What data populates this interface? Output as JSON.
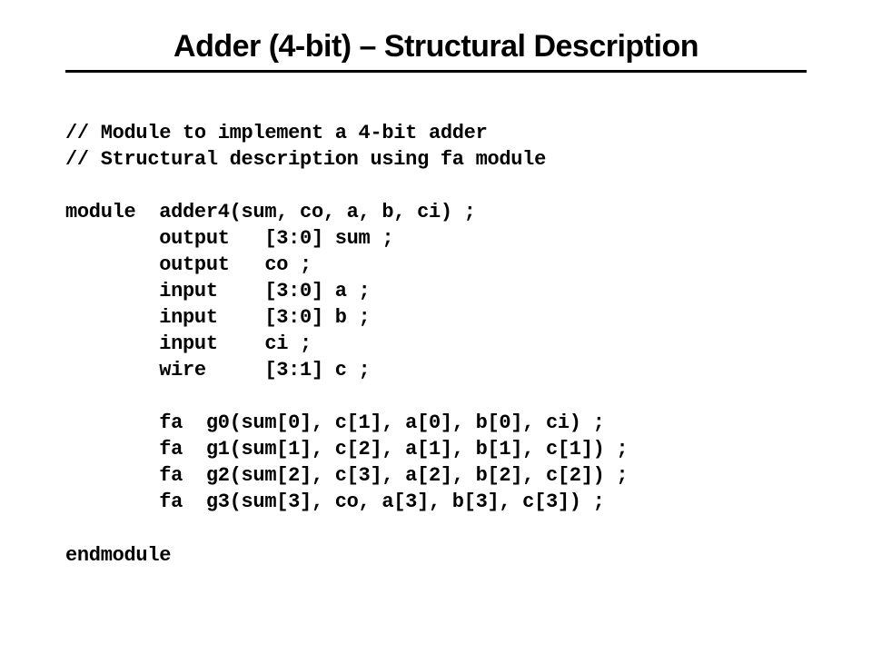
{
  "title": "Adder (4-bit) – Structural Description",
  "code": {
    "l01": "// Module to implement a 4-bit adder",
    "l02": "// Structural description using fa module",
    "l03": "",
    "l04": "module  adder4(sum, co, a, b, ci) ;",
    "l05": "        output   [3:0] sum ;",
    "l06": "        output   co ;",
    "l07": "        input    [3:0] a ;",
    "l08": "        input    [3:0] b ;",
    "l09": "        input    ci ;",
    "l10": "        wire     [3:1] c ;",
    "l11": "",
    "l12": "        fa  g0(sum[0], c[1], a[0], b[0], ci) ;",
    "l13": "        fa  g1(sum[1], c[2], a[1], b[1], c[1]) ;",
    "l14": "        fa  g2(sum[2], c[3], a[2], b[2], c[2]) ;",
    "l15": "        fa  g3(sum[3], co, a[3], b[3], c[3]) ;",
    "l16": "",
    "l17": "endmodule"
  }
}
